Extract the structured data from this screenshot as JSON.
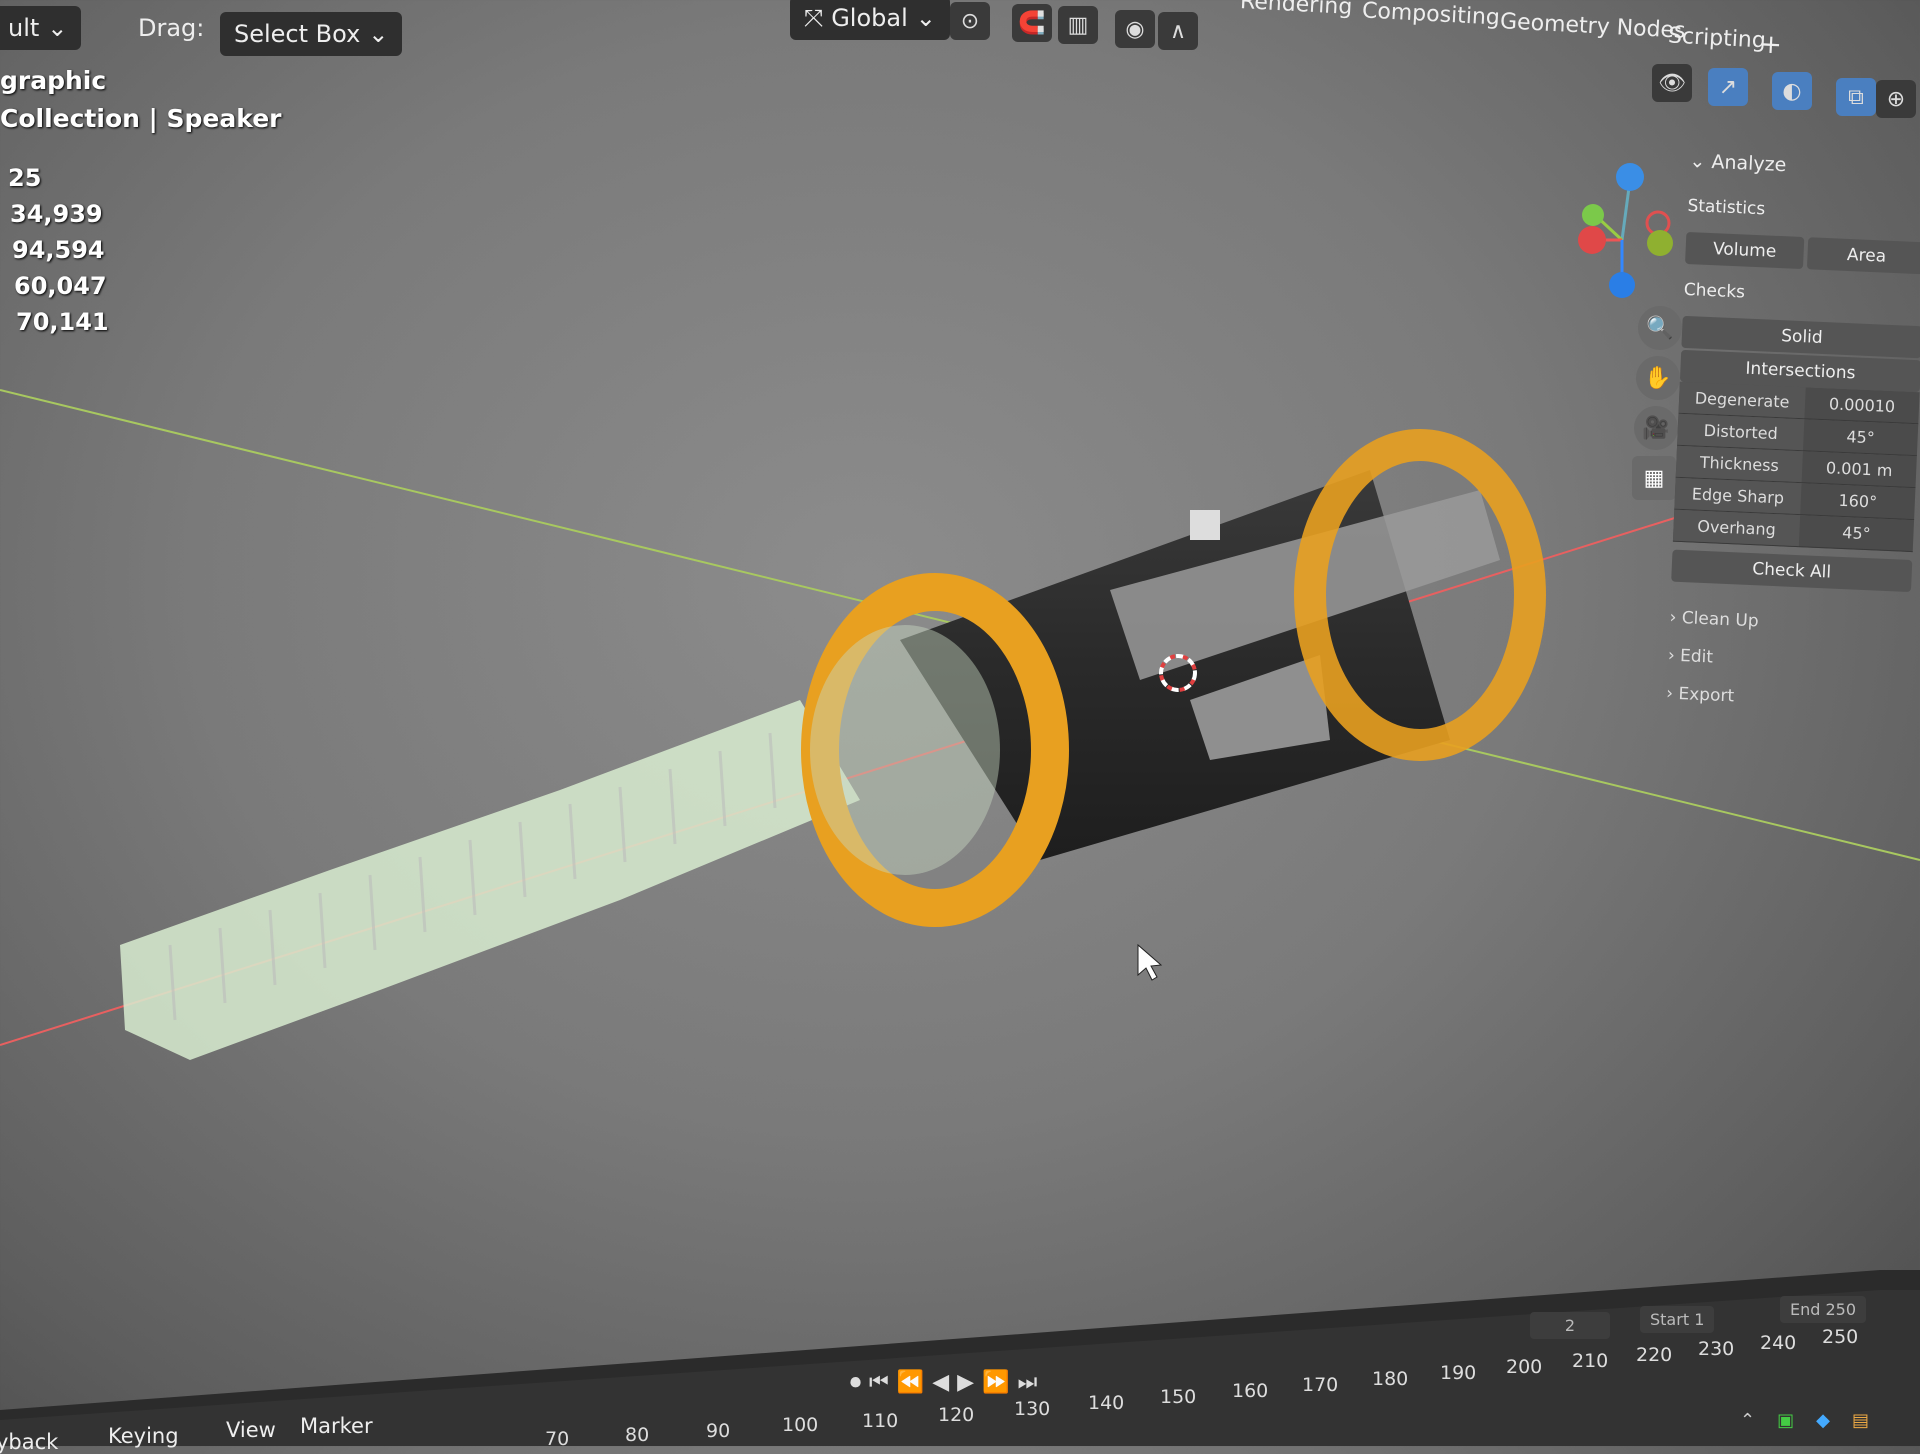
{
  "header": {
    "mode_partial": "ult",
    "drag_label": "Drag:",
    "drag_value": "Select Box",
    "transform_orientation": "Global",
    "workspace_tabs": [
      "Rendering",
      "Compositing",
      "Geometry Nodes",
      "Scripting"
    ],
    "add_tab": "+"
  },
  "overlay": {
    "view_name_partial": "graphic",
    "collection_partial": "Collection",
    "separator": "|",
    "active_object": "Speaker",
    "stats": [
      "25",
      "34,939",
      "94,594",
      "60,047",
      "70,141"
    ]
  },
  "sidebar": {
    "section": "Analyze",
    "statistics_label": "Statistics",
    "volume_button": "Volume",
    "area_button": "Area",
    "checks_label": "Checks",
    "solid_button": "Solid",
    "intersections_button": "Intersections",
    "rows": [
      {
        "label": "Degenerate",
        "value": "0.00010"
      },
      {
        "label": "Distorted",
        "value": "45°"
      },
      {
        "label": "Thickness",
        "value": "0.001 m"
      },
      {
        "label": "Edge Sharp",
        "value": "160°"
      },
      {
        "label": "Overhang",
        "value": "45°"
      }
    ],
    "check_all": "Check All",
    "collapsed": [
      "Clean Up",
      "Edit",
      "Export"
    ]
  },
  "timeline": {
    "menus": [
      "yback",
      "Keying",
      "View",
      "Marker"
    ],
    "current_frame": "2",
    "start_label": "Start",
    "start_value": "1",
    "end_label": "End",
    "end_value": "250",
    "ticks_bottom": [
      "70",
      "80",
      "90",
      "100",
      "110",
      "120",
      "130",
      "140",
      "150",
      "160",
      "170",
      "180",
      "190",
      "200",
      "210",
      "220",
      "230",
      "240",
      "250"
    ]
  },
  "colors": {
    "viewport": "#7a7a7a",
    "orange": "#e8a020",
    "green_axis": "#a8c860",
    "red_axis": "#e86060",
    "handle": "#d8ecd0"
  }
}
